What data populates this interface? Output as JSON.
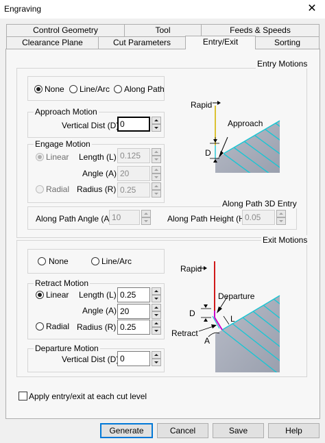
{
  "window": {
    "title": "Engraving",
    "close_glyph": "✕"
  },
  "tabs_row1": [
    "Control Geometry",
    "Tool",
    "Feeds & Speeds"
  ],
  "tabs_row2": [
    "Clearance Plane",
    "Cut Parameters",
    "Entry/Exit",
    "Sorting"
  ],
  "active_tab": "Entry/Exit",
  "entry": {
    "section_label": "Entry Motions",
    "mode_options": [
      "None",
      "Line/Arc",
      "Along Path"
    ],
    "mode_selected": "None",
    "approach": {
      "label": "Approach Motion",
      "vertical_dist_label": "Vertical Dist (D):",
      "vertical_dist_value": "0"
    },
    "engage": {
      "label": "Engage Motion",
      "linear_label": "Linear",
      "radial_label": "Radial",
      "length_label": "Length (L)",
      "length_value": "0.125",
      "angle_label": "Angle (A)",
      "angle_value": "20",
      "radius_label": "Radius (R)",
      "radius_value": "0.25"
    },
    "along3d": {
      "label": "Along Path 3D Entry",
      "angle_label": "Along Path Angle (A)",
      "angle_value": "10",
      "height_label": "Along Path Height (H)",
      "height_value": "0.05"
    },
    "diagram": {
      "rapid": "Rapid",
      "approach": "Approach",
      "d": "D"
    }
  },
  "exit": {
    "section_label": "Exit Motions",
    "mode_options": [
      "None",
      "Line/Arc"
    ],
    "retract": {
      "label": "Retract Motion",
      "linear_label": "Linear",
      "radial_label": "Radial",
      "length_label": "Length (L)",
      "length_value": "0.25",
      "angle_label": "Angle (A)",
      "angle_value": "20",
      "radius_label": "Radius (R)",
      "radius_value": "0.25",
      "linear_selected": true
    },
    "departure": {
      "label": "Departure Motion",
      "vertical_dist_label": "Vertical Dist (D):",
      "vertical_dist_value": "0"
    },
    "diagram": {
      "rapid": "Rapid",
      "departure": "Departure",
      "d": "D",
      "l": "L",
      "retract": "Retract",
      "a": "A"
    }
  },
  "apply_checkbox_label": "Apply entry/exit at each cut level",
  "buttons": {
    "generate": "Generate",
    "cancel": "Cancel",
    "save": "Save",
    "help": "Help"
  },
  "colors": {
    "rapid_entry": "#d4b400",
    "rapid_exit": "#cc0000",
    "departure_path": "#c800c8",
    "cyan_lines": "#19c6d4",
    "accent": "#0078d7"
  }
}
